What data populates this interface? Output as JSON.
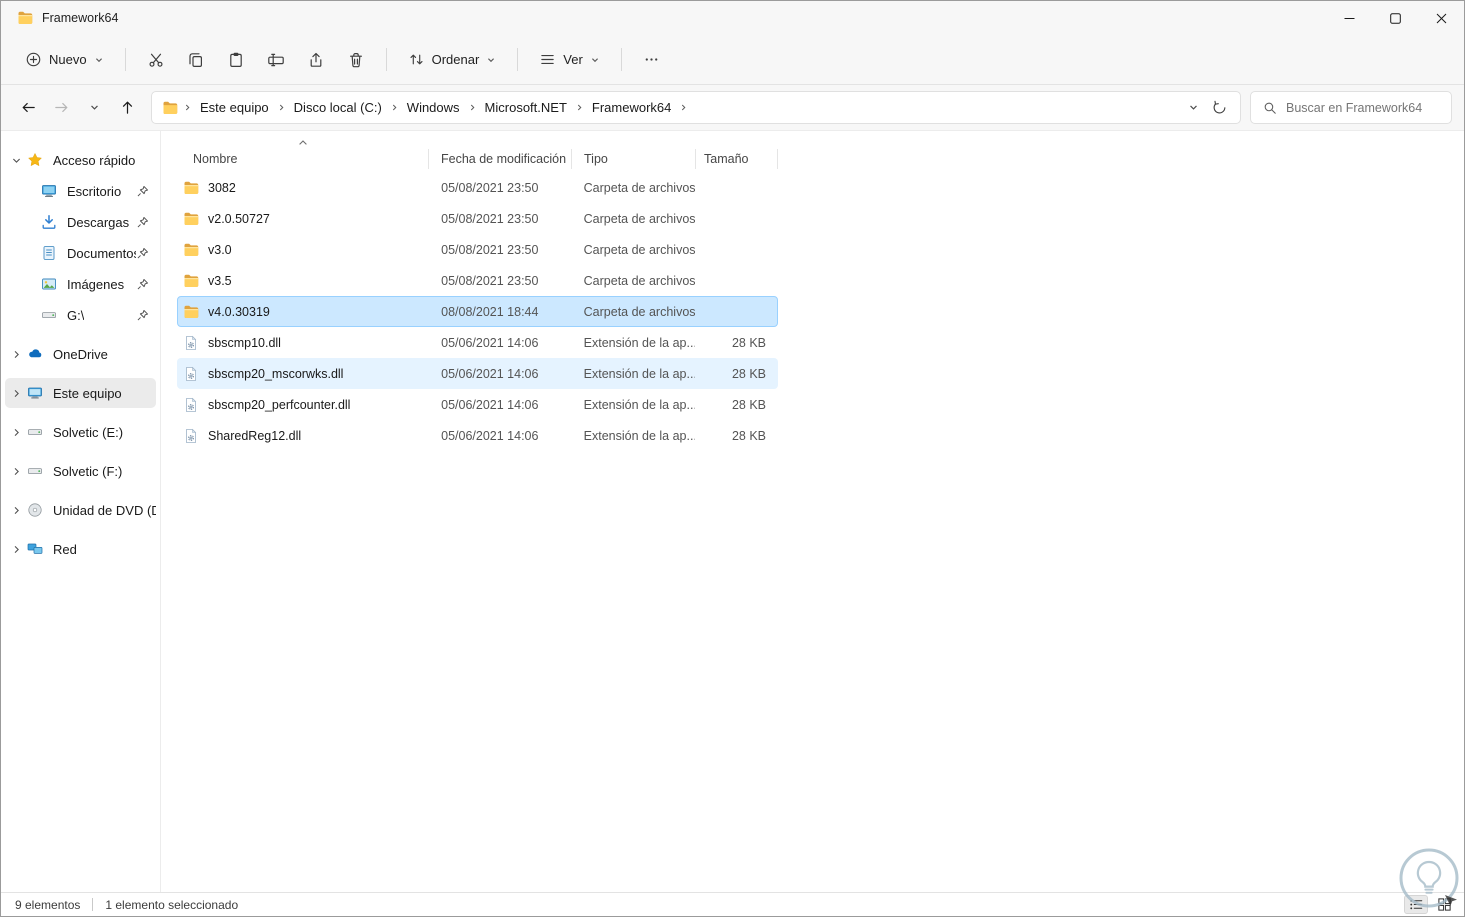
{
  "window": {
    "title": "Framework64"
  },
  "toolbar": {
    "new_label": "Nuevo",
    "sort_label": "Ordenar",
    "view_label": "Ver"
  },
  "navigation": {
    "breadcrumbs": [
      "Este equipo",
      "Disco local (C:)",
      "Windows",
      "Microsoft.NET",
      "Framework64"
    ],
    "search_placeholder": "Buscar en Framework64"
  },
  "sidebar": {
    "items": [
      {
        "label": "Acceso rápido"
      },
      {
        "label": "Escritorio"
      },
      {
        "label": "Descargas"
      },
      {
        "label": "Documentos"
      },
      {
        "label": "Imágenes"
      },
      {
        "label": "G:\\"
      },
      {
        "label": "OneDrive"
      },
      {
        "label": "Este equipo"
      },
      {
        "label": "Solvetic (E:)"
      },
      {
        "label": "Solvetic (F:)"
      },
      {
        "label": "Unidad de DVD (D:)"
      },
      {
        "label": "Red"
      }
    ]
  },
  "filelist": {
    "columns": [
      "Nombre",
      "Fecha de modificación",
      "Tipo",
      "Tamaño"
    ],
    "rows": [
      {
        "name": "3082",
        "date": "05/08/2021 23:50",
        "type": "Carpeta de archivos",
        "size": "",
        "kind": "folder"
      },
      {
        "name": "v2.0.50727",
        "date": "05/08/2021 23:50",
        "type": "Carpeta de archivos",
        "size": "",
        "kind": "folder"
      },
      {
        "name": "v3.0",
        "date": "05/08/2021 23:50",
        "type": "Carpeta de archivos",
        "size": "",
        "kind": "folder"
      },
      {
        "name": "v3.5",
        "date": "05/08/2021 23:50",
        "type": "Carpeta de archivos",
        "size": "",
        "kind": "folder"
      },
      {
        "name": "v4.0.30319",
        "date": "08/08/2021 18:44",
        "type": "Carpeta de archivos",
        "size": "",
        "kind": "folder",
        "selected": true
      },
      {
        "name": "sbscmp10.dll",
        "date": "05/06/2021 14:06",
        "type": "Extensión de la ap...",
        "size": "28 KB",
        "kind": "dll"
      },
      {
        "name": "sbscmp20_mscorwks.dll",
        "date": "05/06/2021 14:06",
        "type": "Extensión de la ap...",
        "size": "28 KB",
        "kind": "dll",
        "hovered": true
      },
      {
        "name": "sbscmp20_perfcounter.dll",
        "date": "05/06/2021 14:06",
        "type": "Extensión de la ap...",
        "size": "28 KB",
        "kind": "dll"
      },
      {
        "name": "SharedReg12.dll",
        "date": "05/06/2021 14:06",
        "type": "Extensión de la ap...",
        "size": "28 KB",
        "kind": "dll"
      }
    ]
  },
  "statusbar": {
    "items_count": "9 elementos",
    "selected_count": "1 elemento seleccionado"
  },
  "colors": {
    "selection_fill": "#cce8ff",
    "selection_border": "#99d1ff",
    "hover_fill": "#e5f3ff",
    "folder_yellow": "#ffd05e",
    "chrome_gray": "#f7f7f7"
  }
}
